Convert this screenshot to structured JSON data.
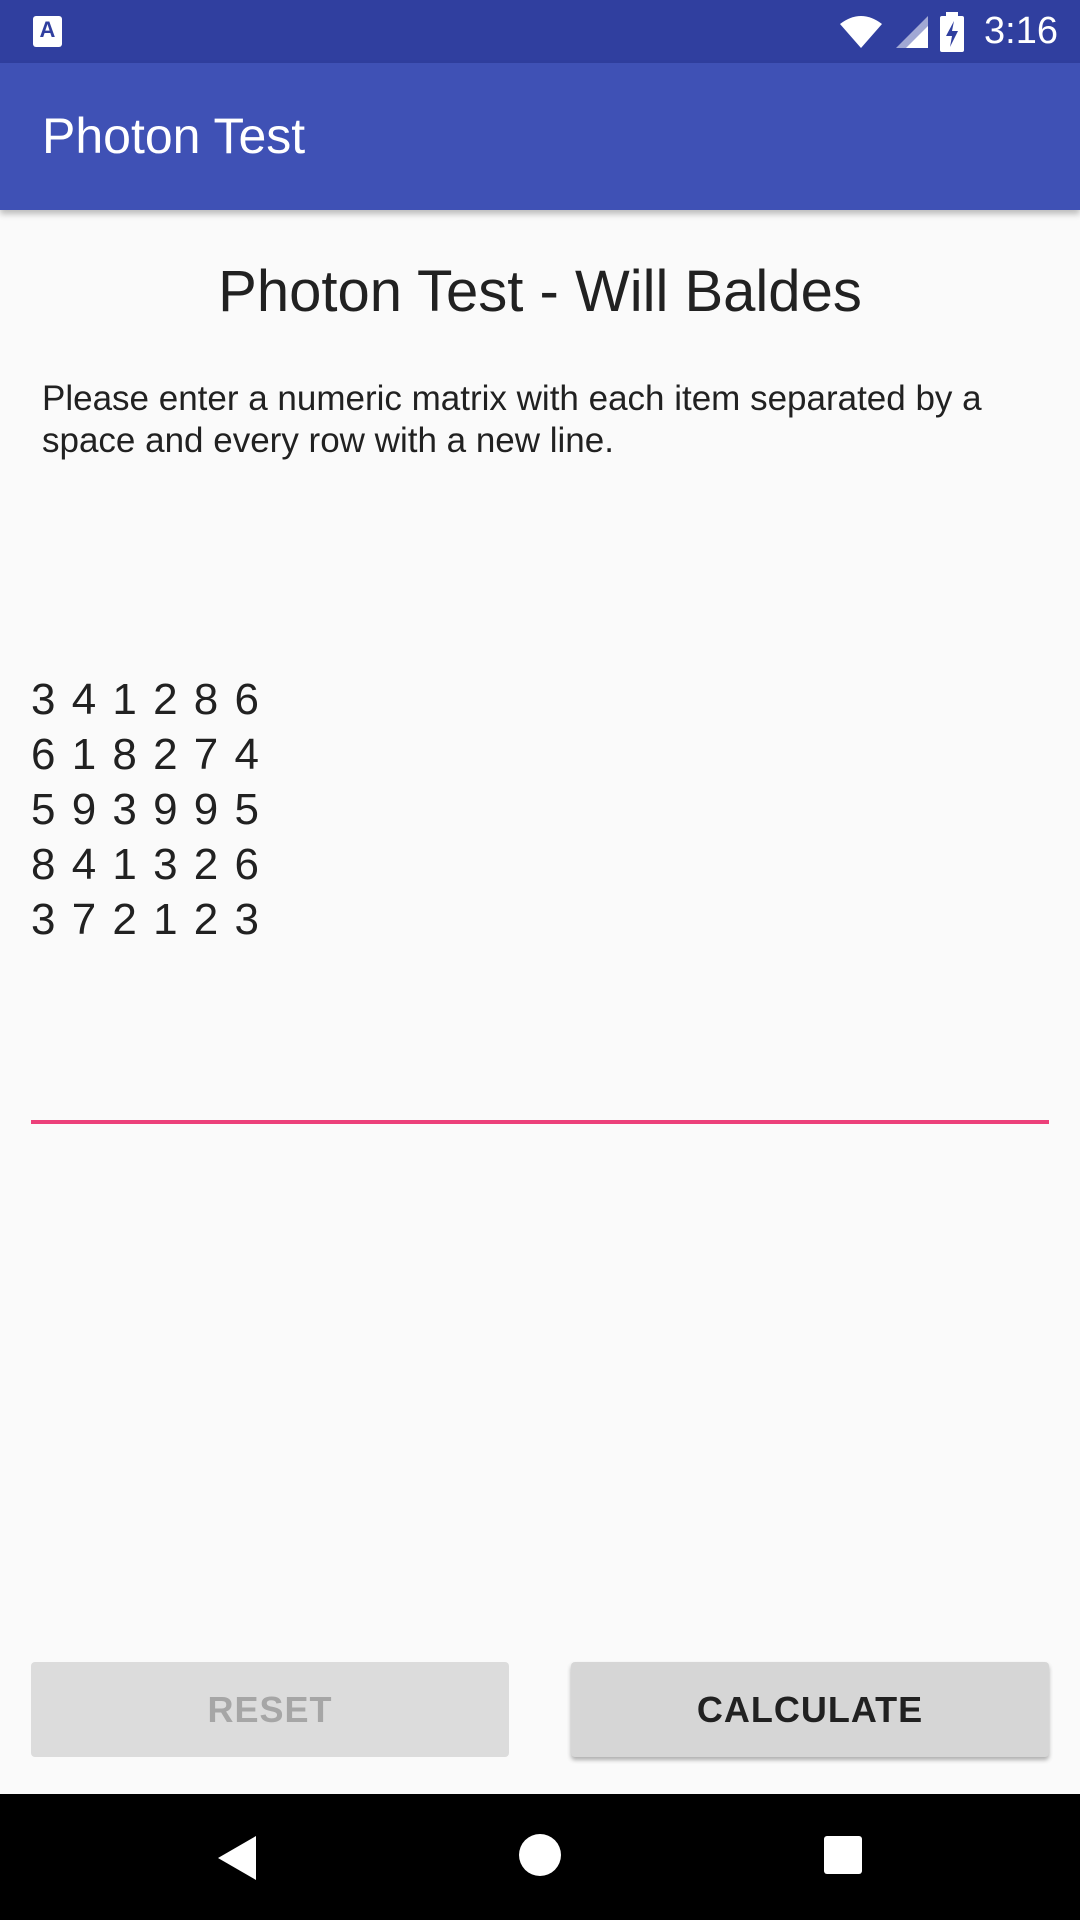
{
  "status_bar": {
    "time": "3:16",
    "notification_icon": "keyboard-a-icon",
    "notification_glyph": "A",
    "icons": [
      "wifi-icon",
      "cell-signal-icon",
      "battery-charging-icon"
    ]
  },
  "app_bar": {
    "title": "Photon Test"
  },
  "main": {
    "heading": "Photon Test - Will Baldes",
    "instructions": "Please enter a numeric matrix with each item separated by a space and every row with a new line.",
    "matrix_rows": [
      "3 4 1 2 8 6",
      "6 1 8 2 7 4",
      "5 9 3 9 9 5",
      "8 4 1 3 2 6",
      "3 7 2 1 2 3"
    ]
  },
  "buttons": {
    "reset_label": "RESET",
    "calculate_label": "CALCULATE"
  },
  "nav_bar": {
    "icons": [
      "back-icon",
      "home-icon",
      "recents-icon"
    ]
  },
  "colors": {
    "status_bar": "#303f9f",
    "app_bar": "#3f51b5",
    "accent": "#ec407a",
    "background": "#fafafa"
  }
}
